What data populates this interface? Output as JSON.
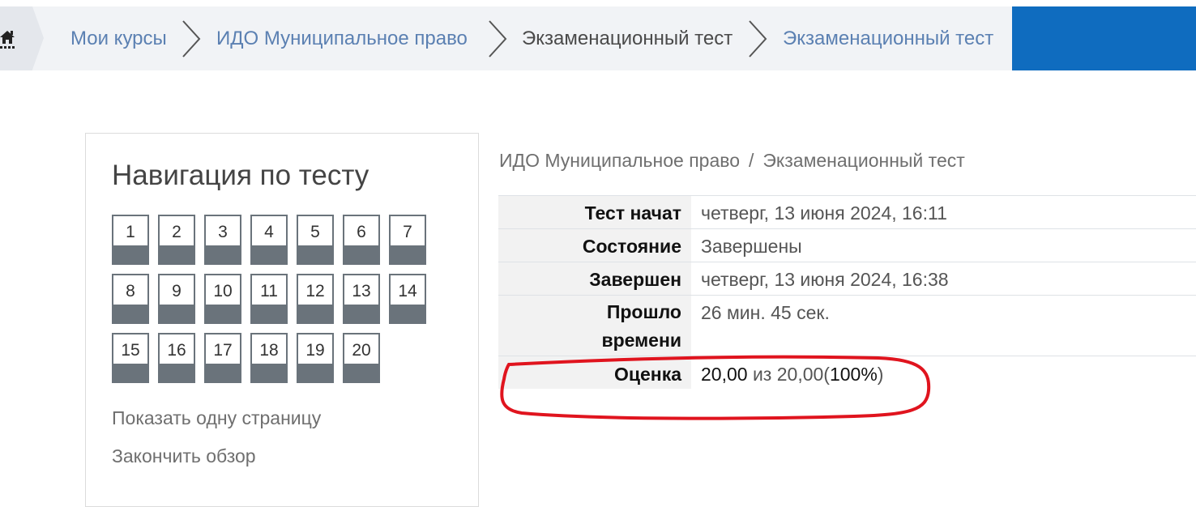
{
  "breadcrumb": {
    "home_icon": "home-icon",
    "items": [
      {
        "label": "Мои курсы"
      },
      {
        "label": "ИДО Муниципальное право"
      },
      {
        "label": "Экзаменационный тест"
      },
      {
        "label": "Экзаменационный тест"
      }
    ]
  },
  "nav": {
    "title": "Навигация по тесту",
    "questions": [
      "1",
      "2",
      "3",
      "4",
      "5",
      "6",
      "7",
      "8",
      "9",
      "10",
      "11",
      "12",
      "13",
      "14",
      "15",
      "16",
      "17",
      "18",
      "19",
      "20"
    ],
    "show_one_page": "Показать одну страницу",
    "finish_review": "Закончить обзор"
  },
  "summary": {
    "course_crumb": "ИДО Муниципальное право",
    "separator": "/",
    "quiz_crumb": "Экзаменационный тест",
    "rows": [
      {
        "label": "Тест начат",
        "value": "четверг, 13 июня 2024, 16:11"
      },
      {
        "label": "Состояние",
        "value": "Завершены"
      },
      {
        "label": "Завершен",
        "value": "четверг, 13 июня 2024, 16:38"
      },
      {
        "label_line1": "Прошло",
        "label_line2": "времени",
        "value": "26 мин. 45 сек."
      }
    ],
    "grade": {
      "label": "Оценка",
      "score": "20,00",
      "of_text": "из 20,00",
      "percent_open": "(",
      "percent": "100%",
      "percent_close": ")"
    }
  },
  "colors": {
    "accent_blue": "#0f6cbf",
    "link": "#5b80b2",
    "highlight_oval": "#e0141e"
  }
}
